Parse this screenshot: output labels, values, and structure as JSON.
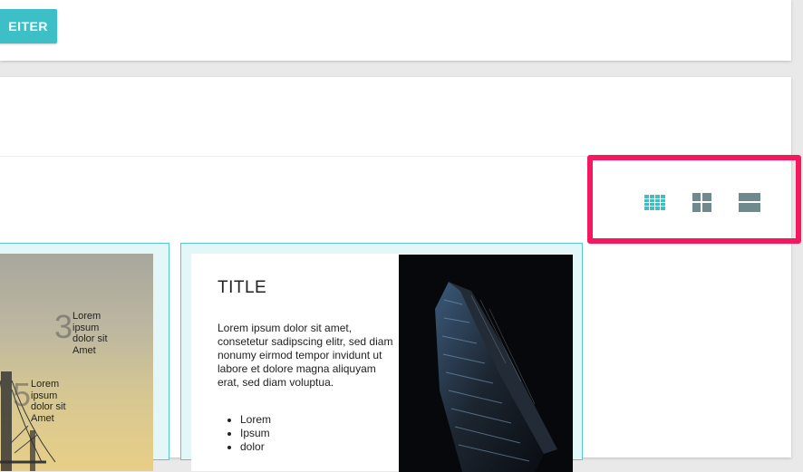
{
  "top_card": {
    "next_button_label": "EITER"
  },
  "view_switcher": {
    "options": [
      {
        "name": "small-grid",
        "icon": "view-module-icon",
        "active": true
      },
      {
        "name": "large-grid",
        "icon": "view-quilt-icon",
        "active": false
      },
      {
        "name": "list",
        "icon": "view-stream-icon",
        "active": false
      }
    ],
    "active_color": "#3dbfc8",
    "inactive_color": "#6f8a8c",
    "highlight_color": "#f4185f"
  },
  "tiles": {
    "stats": [
      {
        "number": "3",
        "text": [
          "Lorem",
          "ipsum",
          "dolor sit",
          "Amet"
        ]
      },
      {
        "number": "5",
        "text": [
          "Lorem",
          "ipsum",
          "dolor sit",
          "Amet"
        ]
      }
    ],
    "content_tile": {
      "title": "TITLE",
      "body": "Lorem ipsum dolor sit amet, consetetur sadipscing elitr, sed diam nonumy eirmod tempor invidunt ut labore et dolore magna aliquyam erat, sed diam voluptua.",
      "list": [
        "Lorem",
        "Ipsum",
        "dolor"
      ]
    }
  }
}
